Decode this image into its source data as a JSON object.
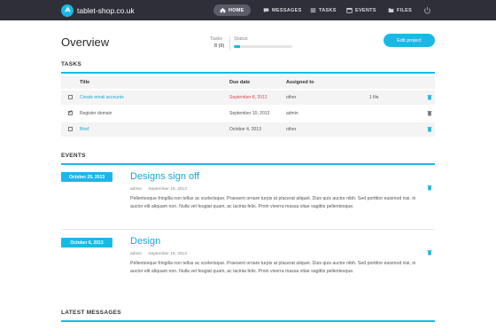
{
  "brand": {
    "name": "tablet-shop.co.uk"
  },
  "nav": [
    {
      "label": "HOME",
      "icon": "home-icon",
      "active": true
    },
    {
      "label": "MESSAGES",
      "icon": "chat-icon",
      "active": false
    },
    {
      "label": "TASKS",
      "icon": "list-icon",
      "active": false
    },
    {
      "label": "EVENTS",
      "icon": "calendar-icon",
      "active": false
    },
    {
      "label": "FILES",
      "icon": "folder-icon",
      "active": false
    }
  ],
  "overview": {
    "title": "Overview",
    "tasks_label": "Tasks",
    "tasks_value": "8 (9)",
    "status_label": "Status",
    "status_progress": 0.1,
    "edit_button": "Edit project"
  },
  "tasks": {
    "heading": "TASKS",
    "columns": {
      "title": "Title",
      "due": "Due date",
      "assigned": "Assigned to"
    },
    "rows": [
      {
        "title": "Create email accounts",
        "due": "September 8, 2013",
        "assigned": "other",
        "files": "1 file",
        "checked": false,
        "link": true,
        "overdue": true
      },
      {
        "title": "Register domain",
        "due": "September 10, 2013",
        "assigned": "admin",
        "files": "",
        "checked": true,
        "link": false,
        "overdue": false
      },
      {
        "title": "Brief",
        "due": "October 4, 2013",
        "assigned": "other",
        "files": "",
        "checked": false,
        "link": true,
        "overdue": false
      }
    ]
  },
  "events": {
    "heading": "EVENTS",
    "items": [
      {
        "date": "October 25, 2013",
        "title": "Designs sign off",
        "author": "admin",
        "posted": "September 16, 2013",
        "body": "Pellentesque fringilla non tellus ac scelerisque. Praesent ornare turpis at placerat aliquet. Duis quis auctor nibh. Sed porttitor euismod nisi, in auctor elit aliquam non. Nulla vel feugiat quam, ac lacinia felis. Proin viverra massa vitae sagittis pellentesque."
      },
      {
        "date": "October 6, 2013",
        "title": "Design",
        "author": "admin",
        "posted": "September 16, 2013",
        "body": "Pellentesque fringilla non tellus ac scelerisque. Praesent ornare turpis at placerat aliquet. Duis quis auctor nibh. Sed porttitor euismod nisi, in auctor elit aliquam non. Nulla vel feugiat quam, ac lacinia felis. Proin viverra massa vitae sagittis pellentesque."
      }
    ]
  },
  "messages": {
    "heading": "LATEST MESSAGES"
  },
  "colors": {
    "accent": "#1bb8e6",
    "topbar": "#2e2f38",
    "danger": "#e04646"
  }
}
